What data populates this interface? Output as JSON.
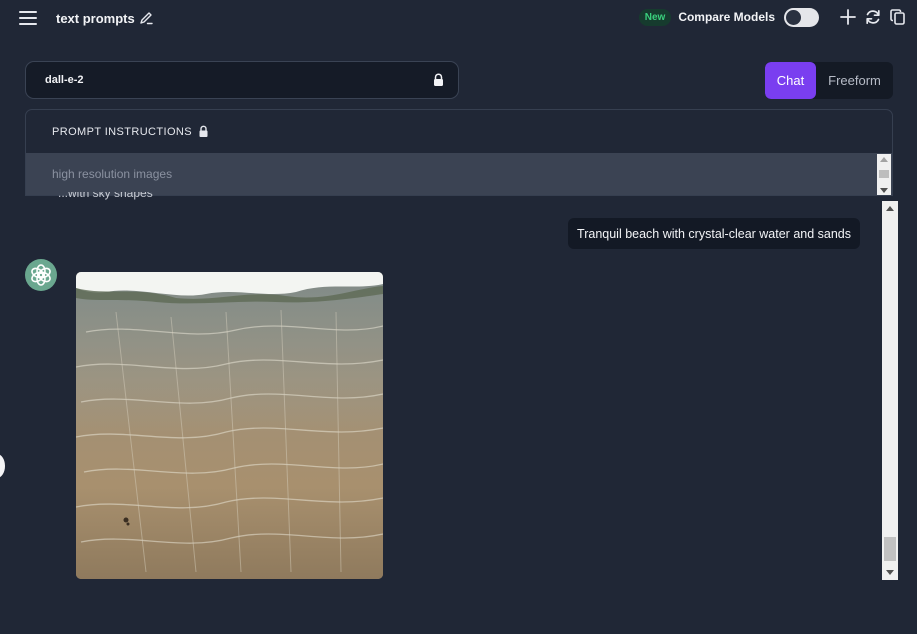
{
  "header": {
    "title": "text prompts",
    "new_badge": "New",
    "compare_label": "Compare Models",
    "compare_enabled": false,
    "icons": [
      "hamburger-menu-icon",
      "edit-pencil-icon",
      "plus-icon",
      "refresh-icon",
      "copy-icon"
    ]
  },
  "model_select": {
    "value": "dall-e-2",
    "locked": true
  },
  "mode_switch": {
    "options": [
      "Chat",
      "Freeform"
    ],
    "selected": "Chat"
  },
  "prompt_instructions": {
    "label": "PROMPT INSTRUCTIONS",
    "value": "high resolution images",
    "locked": true
  },
  "chat": {
    "cut_off_text": "...with sky shapes",
    "user_message": "Tranquil beach with crystal-clear water and sands",
    "assistant": {
      "avatar": "openai-logo-icon",
      "image_description_icon": "generated-beach-image"
    }
  },
  "colors": {
    "background": "#202736",
    "accent": "#7a3ef0",
    "new_badge": "#3ad07d",
    "avatar": "#6aa78f"
  }
}
